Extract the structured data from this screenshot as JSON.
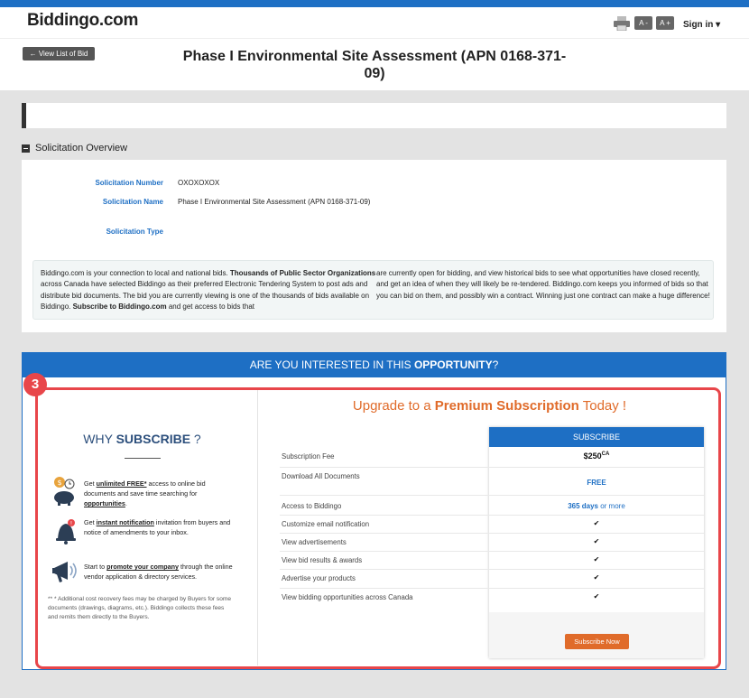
{
  "header": {
    "logo": "Biddingo.com",
    "font_decrease": "A -",
    "font_increase": "A +",
    "sign_in": "Sign in ▾"
  },
  "title_area": {
    "back_button": "← View List of Bid",
    "title": "Phase I Environmental Site Assessment (APN 0168-371-09)"
  },
  "overview": {
    "heading": "Solicitation Overview",
    "fields": [
      {
        "label": "Solicitation Number",
        "value": "OXOXOXOX"
      },
      {
        "label": "Solicitation Name",
        "value": "Phase I Environmental Site Assessment (APN 0168-371-09)"
      },
      {
        "label": "Solicitation Type",
        "value": ""
      }
    ],
    "info": {
      "p1": "Biddingo.com is your connection to local and national bids. ",
      "b1": "Thousands of Public Sector Organizations",
      "p2": " across Canada have selected Biddingo as their preferred Electronic Tendering System to post ads and distribute bid documents. The bid you are currently viewing is one of the thousands of bids available on Biddingo. ",
      "b2": "Subscribe to Biddingo.com",
      "p3": " and get access to bids that",
      "col2": "are currently open for bidding, and view historical bids to see what opportunities have closed recently, and get an idea of when they will likely be re-tendered. Biddingo.com keeps you informed of bids so that you can bid on them, and possibly win a contract. Winning just one contract can make a huge difference!"
    }
  },
  "opportunity": {
    "heading_prefix": "ARE YOU INTERESTED IN THIS ",
    "heading_bold": "OPPORTUNITY",
    "heading_suffix": "?",
    "badge": "3",
    "why": {
      "prefix": "WHY ",
      "bold": "SUBSCRIBE",
      "suffix": " ?"
    },
    "features": [
      {
        "pre": "Get ",
        "link": "unlimited FREE*",
        "post": " access to online bid documents and save time searching for ",
        "link2": "opportunities",
        "post2": "."
      },
      {
        "pre": "Get ",
        "link": "instant notification",
        "post": " invitation from buyers and notice of amendments to your inbox.",
        "link2": "",
        "post2": ""
      },
      {
        "pre": "Start to ",
        "link": "promote your company",
        "post": " through the online vendor application & directory services.",
        "link2": "",
        "post2": ""
      }
    ],
    "disclaimer": "** * Additional cost recovery fees may be charged by Buyers for some documents (drawings, diagrams, etc.). Biddingo collects these fees and remits them directly to the Buyers.",
    "upgrade": {
      "prefix": "Upgrade to a ",
      "bold": "Premium Subscription",
      "suffix": " Today !"
    },
    "subscribe_header": "SUBSCRIBE",
    "rows": [
      {
        "label": "Subscription Fee",
        "value": "$250",
        "sup": "CA"
      },
      {
        "label": "Download All Documents",
        "value": "FREE"
      },
      {
        "label": "Access to Biddingo",
        "value": "365 days",
        "suffix": " or more"
      },
      {
        "label": "Customize email notification",
        "value": "✔"
      },
      {
        "label": "View advertisements",
        "value": "✔"
      },
      {
        "label": "View bid results & awards",
        "value": "✔"
      },
      {
        "label": "Advertise your products",
        "value": "✔"
      },
      {
        "label": "View bidding opportunities across Canada",
        "value": "✔"
      }
    ],
    "subscribe_button": "Subscribe Now"
  },
  "colors": {
    "brand_blue": "#1e6fc4",
    "accent_orange": "#e06b2a",
    "highlight_red": "#e8464a"
  }
}
